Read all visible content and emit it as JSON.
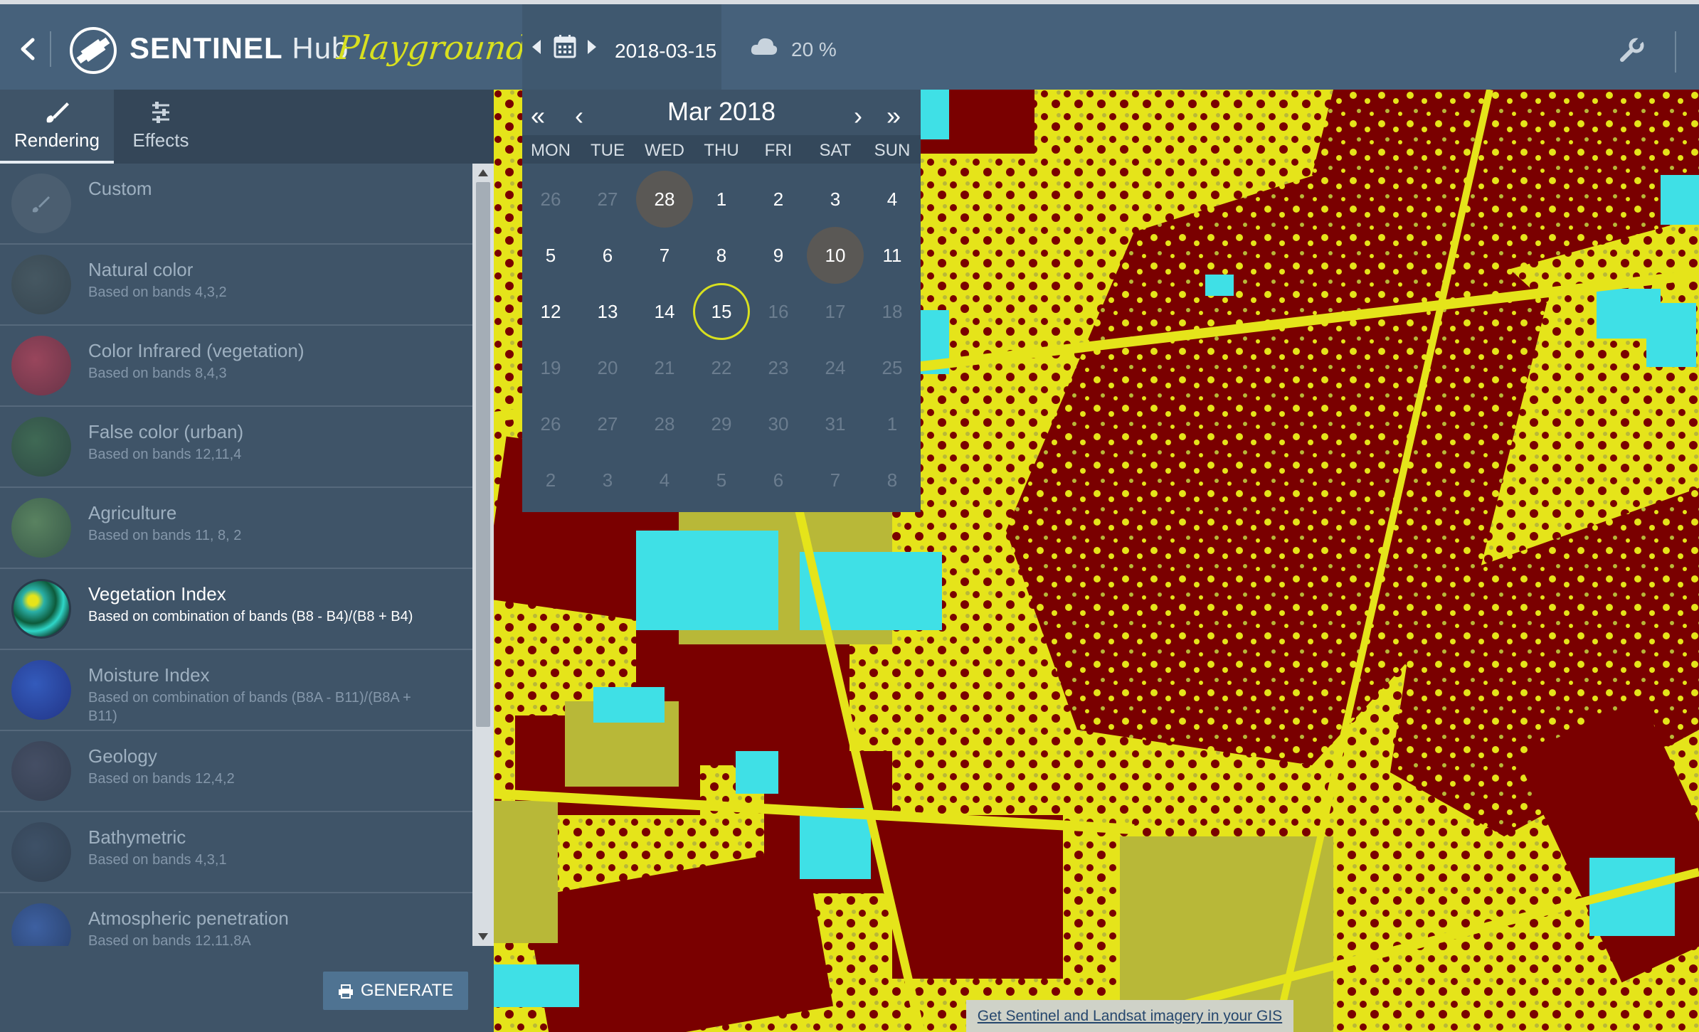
{
  "header": {
    "brand_bold": "SENTINEL",
    "brand_light": "Hub",
    "product": "Playground",
    "date": "2018-03-15",
    "cloud_coverage": "20 %",
    "icons": [
      "back-chevron-icon",
      "satellite-logo-icon",
      "calendar-icon",
      "cloud-icon",
      "wrench-icon"
    ]
  },
  "tabs": [
    {
      "label": "Rendering",
      "icon": "brush-icon"
    },
    {
      "label": "Effects",
      "icon": "sliders-icon"
    }
  ],
  "layers": [
    {
      "title": "Custom",
      "desc": ""
    },
    {
      "title": "Natural color",
      "desc": "Based on bands 4,3,2"
    },
    {
      "title": "Color Infrared (vegetation)",
      "desc": "Based on bands 8,4,3"
    },
    {
      "title": "False color (urban)",
      "desc": "Based on bands 12,11,4"
    },
    {
      "title": "Agriculture",
      "desc": "Based on bands 11, 8, 2"
    },
    {
      "title": "Vegetation Index",
      "desc": "Based on combination of bands (B8 - B4)/(B8 + B4)"
    },
    {
      "title": "Moisture Index",
      "desc": "Based on combination of bands (B8A - B11)/(B8A + B11)"
    },
    {
      "title": "Geology",
      "desc": "Based on bands 12,4,2"
    },
    {
      "title": "Bathymetric",
      "desc": "Based on bands 4,3,1"
    },
    {
      "title": "Atmospheric penetration",
      "desc": "Based on bands 12,11,8A"
    }
  ],
  "active_layer": "Vegetation Index",
  "generate_label": "GENERATE",
  "calendar": {
    "title": "Mar 2018",
    "nav": {
      "prev_year": "«",
      "prev_month": "‹",
      "next_month": "›",
      "next_year": "»"
    },
    "dows": [
      "MON",
      "TUE",
      "WED",
      "THU",
      "FRI",
      "SAT",
      "SUN"
    ],
    "weeks": [
      [
        "26",
        "27",
        "28",
        "1",
        "2",
        "3",
        "4"
      ],
      [
        "5",
        "6",
        "7",
        "8",
        "9",
        "10",
        "11"
      ],
      [
        "12",
        "13",
        "14",
        "15",
        "16",
        "17",
        "18"
      ],
      [
        "19",
        "20",
        "21",
        "22",
        "23",
        "24",
        "25"
      ],
      [
        "26",
        "27",
        "28",
        "29",
        "30",
        "31",
        "1"
      ],
      [
        "2",
        "3",
        "4",
        "5",
        "6",
        "7",
        "8"
      ]
    ]
  },
  "attribution": "Get Sentinel and Landsat imagery in your GIS",
  "colors": {
    "topbar": "#46617b",
    "sidebar": "#3f5468",
    "accent_yellow": "#d8e01f",
    "map_dark_red": "#7a0000",
    "map_yellow": "#e5e41a",
    "map_olive": "#b8b838",
    "map_cyan": "#3fe0e6"
  }
}
